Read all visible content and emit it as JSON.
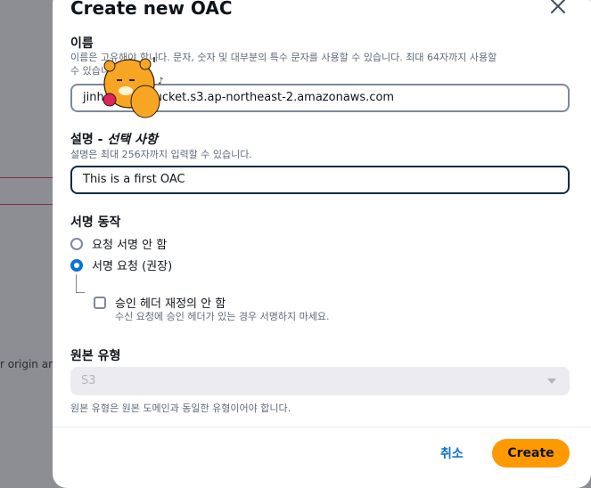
{
  "background": {
    "text": "r origin and"
  },
  "modal": {
    "title": "Create new OAC",
    "name": {
      "label": "이름",
      "description_line1": "이름은 고유해야 합니다. 문자, 숫자 및 대부분의 특수 문자를 사용할 수 있습니다. 최대 64자까지 사용할",
      "description_line2": "수 있습니다.",
      "value": "jinhee-oac-bucket.s3.ap-northeast-2.amazonaws.com"
    },
    "description": {
      "label_main": "설명 - ",
      "label_optional": "선택 사항",
      "hint": "설명은 최대 256자까지 입력할 수 있습니다.",
      "value": "This is a first OAC"
    },
    "signing": {
      "label": "서명 동작",
      "options": [
        {
          "label": "요청 서명 안 함",
          "checked": false
        },
        {
          "label": "서명 요청 (권장)",
          "checked": true
        }
      ],
      "sub_option": {
        "label": "승인 헤더 재정의 안 함",
        "description": "수신 요청에 승인 헤더가 있는 경우 서명하지 마세요.",
        "checked": false
      }
    },
    "origin_type": {
      "label": "원본 유형",
      "value": "S3",
      "hint": "원본 유형은 원본 도메인과 동일한 유형이어야 합니다.",
      "disabled": true
    },
    "footer": {
      "cancel_label": "취소",
      "create_label": "Create"
    }
  },
  "colors": {
    "primary_button": "#ff9900",
    "link": "#0972d3",
    "radio_checked": "#0972d3"
  }
}
